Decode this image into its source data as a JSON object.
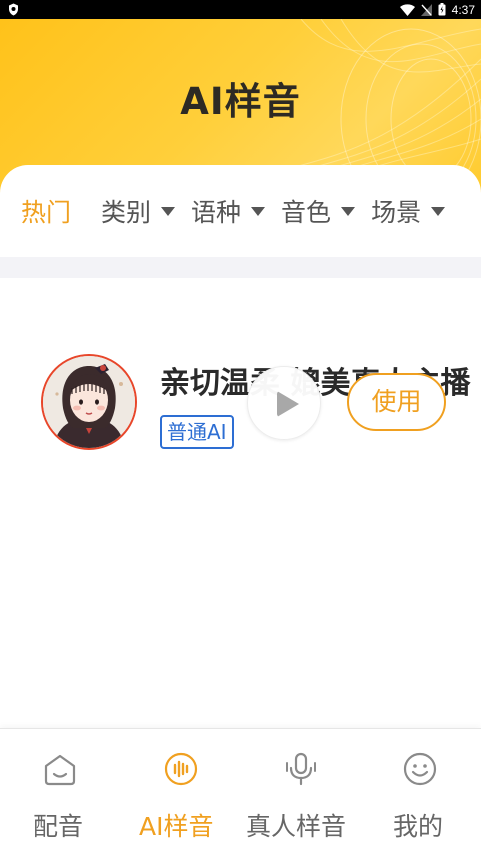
{
  "status_bar": {
    "time": "4:37"
  },
  "header": {
    "title": "AI样音"
  },
  "filters": {
    "active": "热门",
    "dropdowns": [
      "类别",
      "语种",
      "音色",
      "场景"
    ]
  },
  "voices": [
    {
      "name": "亲切温柔 媲美真人主播",
      "tag": "普通AI",
      "action_label": "使用"
    }
  ],
  "bottom_nav": {
    "items": [
      {
        "label": "配音",
        "icon": "home-icon",
        "active": false
      },
      {
        "label": "AI样音",
        "icon": "voice-wave-icon",
        "active": true
      },
      {
        "label": "真人样音",
        "icon": "microphone-icon",
        "active": false
      },
      {
        "label": "我的",
        "icon": "smiley-icon",
        "active": false
      }
    ]
  },
  "colors": {
    "accent": "#f0a020",
    "header_yellow": "#ffc928",
    "tag_blue": "#2d6ed3"
  }
}
